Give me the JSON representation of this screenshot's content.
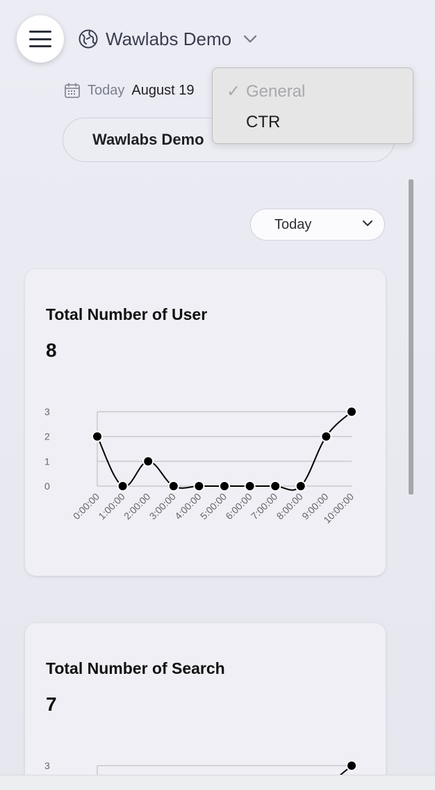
{
  "header": {
    "menu_icon": "hamburger-menu-icon",
    "project_icon": "globe-icon",
    "project_title": "Wawlabs Demo"
  },
  "date": {
    "icon": "calendar-icon",
    "label": "Today",
    "value": "August 19"
  },
  "project_select": {
    "value": "Wawlabs Demo"
  },
  "dropdown": {
    "options": [
      {
        "label": "General",
        "checked": true,
        "disabled": true
      },
      {
        "label": "CTR",
        "checked": false,
        "disabled": false
      }
    ]
  },
  "range_select": {
    "value": "Today"
  },
  "cards": [
    {
      "title": "Total Number of User",
      "value": "8"
    },
    {
      "title": "Total Number of Search",
      "value": "7"
    }
  ],
  "chart_data": [
    {
      "type": "line",
      "title": "Total Number of User",
      "x": [
        "0:00:00",
        "1:00:00",
        "2:00:00",
        "3:00:00",
        "4:00:00",
        "5:00:00",
        "6:00:00",
        "7:00:00",
        "8:00:00",
        "9:00:00",
        "10:00:00"
      ],
      "series": [
        {
          "values": [
            2,
            0,
            1,
            0,
            0,
            0,
            0,
            0,
            0,
            2,
            3
          ]
        }
      ],
      "yticks": [
        0,
        1,
        2,
        3
      ],
      "ylim": [
        0,
        3
      ],
      "grid": true
    },
    {
      "type": "line",
      "title": "Total Number of Search",
      "x": [],
      "series": [
        {
          "values": [
            3
          ]
        }
      ],
      "yticks": [
        3
      ],
      "ylim": [
        0,
        3
      ],
      "grid": true
    }
  ]
}
